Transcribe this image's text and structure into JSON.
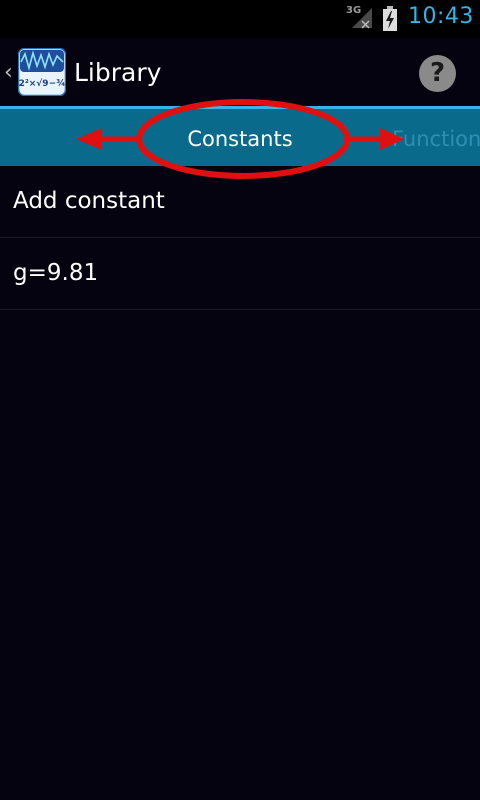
{
  "status_bar": {
    "network": "3G",
    "time": "10:43",
    "icons": [
      "signal-icon",
      "battery-charging-icon"
    ],
    "time_color": "#33b5e5"
  },
  "action_bar": {
    "title": "Library",
    "app_icon": "calculator-app-icon",
    "app_icon_text": "2²×√9−¾",
    "help_label": "?",
    "up_label": "‹"
  },
  "tabs": [
    {
      "label": "Constants",
      "selected": true
    },
    {
      "label": "Functions",
      "selected": false
    }
  ],
  "colors": {
    "tab_strip": "#0a6a8c",
    "accent": "#33b5e5",
    "annotation": "#e01010",
    "background": "#05030f"
  },
  "list": {
    "items": [
      {
        "label": "Add constant"
      },
      {
        "label": "g=9.81"
      }
    ]
  }
}
